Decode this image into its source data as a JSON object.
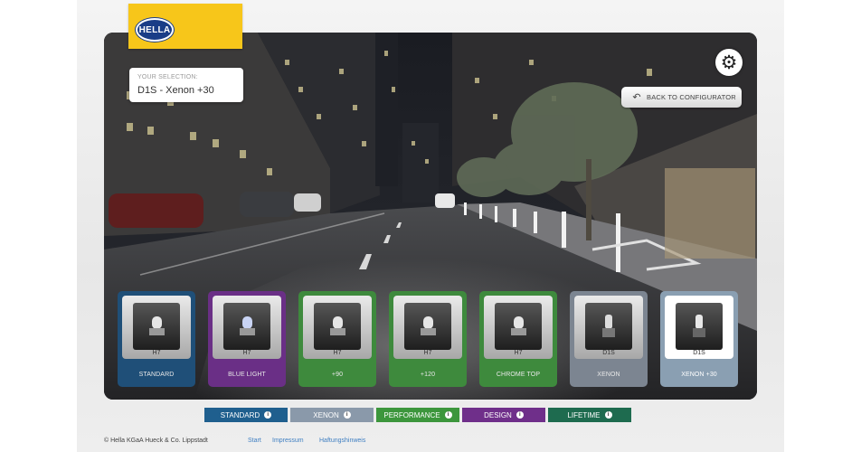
{
  "brand": {
    "logo_text": "HELLA"
  },
  "selection": {
    "label": "YOUR SELECTION:",
    "value": "D1S - Xenon +30"
  },
  "back_button": {
    "label": "BACK TO CONFIGURATOR"
  },
  "products": [
    {
      "type": "H7",
      "name": "STANDARD",
      "color": "#1f4f78"
    },
    {
      "type": "H7",
      "name": "BLUE LIGHT",
      "color": "#6a2f86"
    },
    {
      "type": "H7",
      "name": "+90",
      "color": "#3e8a3d"
    },
    {
      "type": "H7",
      "name": "+120",
      "color": "#3e8a3d"
    },
    {
      "type": "H7",
      "name": "CHROME TOP",
      "color": "#3e8a3d"
    },
    {
      "type": "D1S",
      "name": "XENON",
      "color": "#7c8591"
    },
    {
      "type": "D1S",
      "name": "XENON +30",
      "color": "#8a9fb2",
      "active": true
    }
  ],
  "legend": [
    {
      "label": "STANDARD",
      "color": "#1f5f8e"
    },
    {
      "label": "XENON",
      "color": "#8a99aa"
    },
    {
      "label": "PERFORMANCE",
      "color": "#3c963c"
    },
    {
      "label": "DESIGN",
      "color": "#6f2f8a"
    },
    {
      "label": "LIFETIME",
      "color": "#1e6b4f"
    }
  ],
  "info_glyph": "i",
  "footer": {
    "copyright": "© Hella KGaA Hueck & Co. Lippstadt",
    "links": [
      "Start",
      "Impressum",
      "Haftungshinweis"
    ]
  }
}
